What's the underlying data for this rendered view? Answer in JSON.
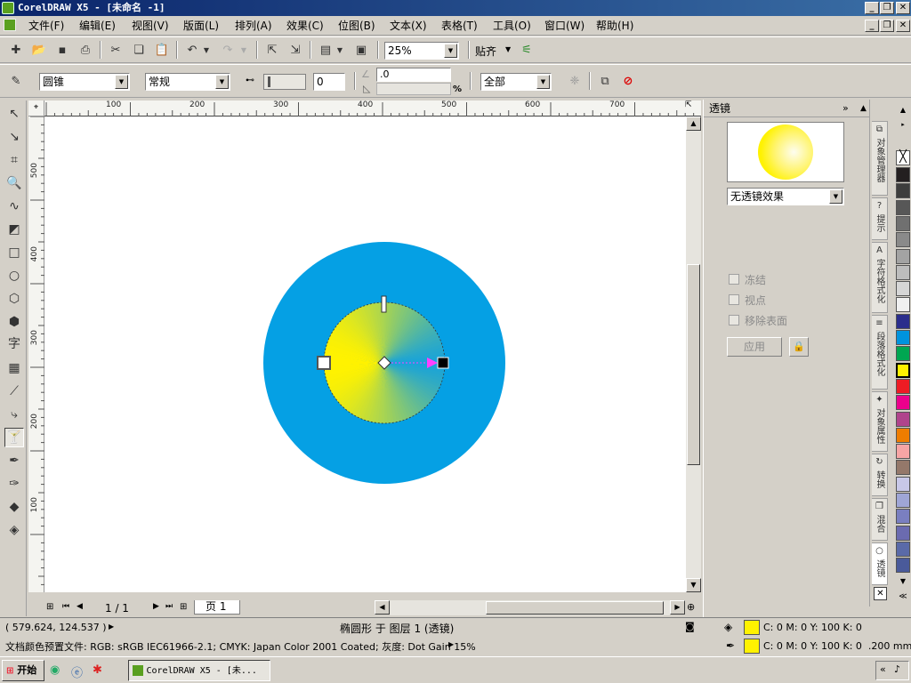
{
  "window": {
    "title": "CorelDRAW X5 - [未命名 -1]",
    "minimize": "_",
    "restore": "❐",
    "close": "✕"
  },
  "menu": [
    "文件(F)",
    "编辑(E)",
    "视图(V)",
    "版面(L)",
    "排列(A)",
    "效果(C)",
    "位图(B)",
    "文本(X)",
    "表格(T)",
    "工具(O)",
    "窗口(W)",
    "帮助(H)"
  ],
  "toolbar": {
    "zoom": "25%",
    "snap_label": "贴齐"
  },
  "property_bar": {
    "transparency_type": "圆锥",
    "merge_mode": "常规",
    "midpoint_value": "0",
    "angle_value": ".0",
    "percent_symbol": "%",
    "apply_to": "全部"
  },
  "ruler": {
    "h_labels": [
      "100",
      "200",
      "300",
      "400",
      "500",
      "600",
      "700"
    ],
    "v_labels": [
      "500",
      "400",
      "300",
      "200",
      "100"
    ]
  },
  "colors": {
    "canvas_circle": "#05a0e4",
    "yellow": "#fff200",
    "cyan_fade": "#1aa3d8",
    "handle_arrow": "#ff40ff"
  },
  "page_nav": {
    "position": "1 / 1",
    "page_tab": "页 1"
  },
  "docker": {
    "title": "透镜",
    "lens_type": "无透镜效果",
    "freeze": "冻结",
    "viewpoint": "视点",
    "remove_face": "移除表面",
    "apply": "应用"
  },
  "side_tabs": [
    "对象管理器",
    "提示",
    "字符格式化",
    "段落格式化",
    "对象属性",
    "转换",
    "混合",
    "透镜"
  ],
  "palette": [
    "#ffffff",
    "#231f20",
    "#3d3d3d",
    "#575757",
    "#707070",
    "#8a8a8a",
    "#a3a3a3",
    "#bdbdbd",
    "#d6d6d6",
    "#f0f0f0",
    "#2b2e8c",
    "#0093dd",
    "#00a651",
    "#fff200",
    "#ed1c24",
    "#ec008c",
    "#b0448c",
    "#ef7d00",
    "#f6a5a5",
    "#94786a",
    "#c8c8e8",
    "#9fa6d6",
    "#7a7fc0",
    "#6b6bb0",
    "#5a6aa8",
    "#4a5a9a"
  ],
  "status": {
    "coords": "( 579.624, 124.537 )",
    "object_info": "椭圆形 于 图层 1 (透镜)",
    "color_profile": "文档颜色预置文件: RGB: sRGB IEC61966-2.1; CMYK: Japan Color 2001 Coated; 灰度: Dot Gain 15%",
    "fill_info": "C: 0 M: 0 Y: 100 K: 0",
    "outline_info": "C: 0 M: 0 Y: 100 K: 0  .200 mm"
  },
  "taskbar": {
    "start": "开始",
    "app_button": "CorelDRAW X5 - [未..."
  }
}
